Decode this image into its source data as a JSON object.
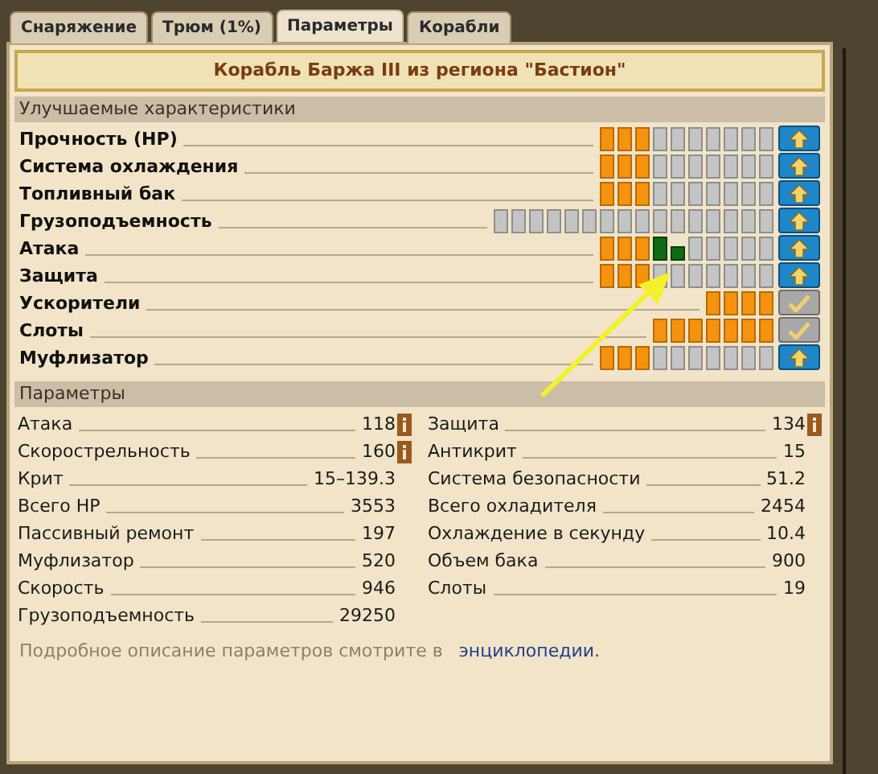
{
  "tabs": [
    {
      "label": "Снаряжение",
      "selected": false
    },
    {
      "label": "Трюм (1%)",
      "selected": false
    },
    {
      "label": "Параметры",
      "selected": true
    },
    {
      "label": "Корабли",
      "selected": false
    }
  ],
  "title": "Корабль Баржа III из региона \"Бастион\"",
  "upgrades": {
    "heading": "Улучшаемые характеристики",
    "rows": [
      {
        "name": "Прочность (HP)",
        "cells": [
          {
            "kind": "done"
          },
          {
            "kind": "done"
          },
          {
            "kind": "done"
          },
          {
            "kind": "empty"
          },
          {
            "kind": "empty"
          },
          {
            "kind": "empty"
          },
          {
            "kind": "empty"
          },
          {
            "kind": "empty"
          },
          {
            "kind": "empty"
          },
          {
            "kind": "empty"
          }
        ],
        "button": {
          "kind": "upgrade"
        }
      },
      {
        "name": "Система охлаждения",
        "cells": [
          {
            "kind": "done"
          },
          {
            "kind": "done"
          },
          {
            "kind": "done"
          },
          {
            "kind": "empty"
          },
          {
            "kind": "empty"
          },
          {
            "kind": "empty"
          },
          {
            "kind": "empty"
          },
          {
            "kind": "empty"
          },
          {
            "kind": "empty"
          },
          {
            "kind": "empty"
          }
        ],
        "button": {
          "kind": "upgrade"
        }
      },
      {
        "name": "Топливный бак",
        "cells": [
          {
            "kind": "done"
          },
          {
            "kind": "done"
          },
          {
            "kind": "done"
          },
          {
            "kind": "empty"
          },
          {
            "kind": "empty"
          },
          {
            "kind": "empty"
          },
          {
            "kind": "empty"
          },
          {
            "kind": "empty"
          },
          {
            "kind": "empty"
          },
          {
            "kind": "empty"
          }
        ],
        "button": {
          "kind": "upgrade"
        }
      },
      {
        "name": "Грузоподъемность",
        "cells": [
          {
            "kind": "empty"
          },
          {
            "kind": "empty"
          },
          {
            "kind": "empty"
          },
          {
            "kind": "empty"
          },
          {
            "kind": "empty"
          },
          {
            "kind": "empty"
          },
          {
            "kind": "empty"
          },
          {
            "kind": "empty"
          },
          {
            "kind": "empty"
          },
          {
            "kind": "empty"
          },
          {
            "kind": "empty"
          },
          {
            "kind": "empty"
          },
          {
            "kind": "empty"
          },
          {
            "kind": "empty"
          },
          {
            "kind": "empty"
          },
          {
            "kind": "empty"
          }
        ],
        "button": {
          "kind": "upgrade"
        }
      },
      {
        "name": "Атака",
        "cells": [
          {
            "kind": "done"
          },
          {
            "kind": "done"
          },
          {
            "kind": "done"
          },
          {
            "kind": "bonus"
          },
          {
            "kind": "partial"
          },
          {
            "kind": "empty"
          },
          {
            "kind": "empty"
          },
          {
            "kind": "empty"
          },
          {
            "kind": "empty"
          },
          {
            "kind": "empty"
          }
        ],
        "button": {
          "kind": "upgrade"
        }
      },
      {
        "name": "Защита",
        "cells": [
          {
            "kind": "done"
          },
          {
            "kind": "done"
          },
          {
            "kind": "done"
          },
          {
            "kind": "empty"
          },
          {
            "kind": "empty"
          },
          {
            "kind": "empty"
          },
          {
            "kind": "empty"
          },
          {
            "kind": "empty"
          },
          {
            "kind": "empty"
          },
          {
            "kind": "empty"
          }
        ],
        "button": {
          "kind": "upgrade"
        }
      },
      {
        "name": "Ускорители",
        "cells": [
          {
            "kind": "done"
          },
          {
            "kind": "done"
          },
          {
            "kind": "done"
          },
          {
            "kind": "done"
          }
        ],
        "button": {
          "kind": "complete"
        }
      },
      {
        "name": "Слоты",
        "cells": [
          {
            "kind": "done"
          },
          {
            "kind": "done"
          },
          {
            "kind": "done"
          },
          {
            "kind": "done"
          },
          {
            "kind": "done"
          },
          {
            "kind": "done"
          },
          {
            "kind": "done"
          }
        ],
        "button": {
          "kind": "complete"
        }
      },
      {
        "name": "Муфлизатор",
        "cells": [
          {
            "kind": "done"
          },
          {
            "kind": "done"
          },
          {
            "kind": "done"
          },
          {
            "kind": "empty"
          },
          {
            "kind": "empty"
          },
          {
            "kind": "empty"
          },
          {
            "kind": "empty"
          },
          {
            "kind": "empty"
          },
          {
            "kind": "empty"
          },
          {
            "kind": "empty"
          }
        ],
        "button": {
          "kind": "upgrade"
        }
      }
    ]
  },
  "parameters": {
    "heading": "Параметры",
    "columns": [
      [
        {
          "name": "Атака",
          "value": "118",
          "info": true
        },
        {
          "name": "Скорострельность",
          "value": "160",
          "info": true
        },
        {
          "name": "Крит",
          "value": "15–139.3",
          "info": false
        },
        {
          "name": "Всего HP",
          "value": "3553",
          "info": false
        },
        {
          "name": "Пассивный ремонт",
          "value": "197",
          "info": false
        },
        {
          "name": "Муфлизатор",
          "value": "520",
          "info": false
        },
        {
          "name": "Скорость",
          "value": "946",
          "info": false
        },
        {
          "name": "Грузоподъемность",
          "value": "29250",
          "info": false
        }
      ],
      [
        {
          "name": "Защита",
          "value": "134",
          "info": true
        },
        {
          "name": "Антикрит",
          "value": "15",
          "info": false
        },
        {
          "name": "Система безопасности",
          "value": "51.2",
          "info": false
        },
        {
          "name": "Всего охладителя",
          "value": "2454",
          "info": false
        },
        {
          "name": "Охлаждение в секунду",
          "value": "10.4",
          "info": false
        },
        {
          "name": "Объем бака",
          "value": "900",
          "info": false
        },
        {
          "name": "Слоты",
          "value": "19",
          "info": false
        }
      ]
    ]
  },
  "footer": {
    "text": "Подробное описание параметров смотрите в",
    "link": "энциклопедии",
    "end": "."
  }
}
